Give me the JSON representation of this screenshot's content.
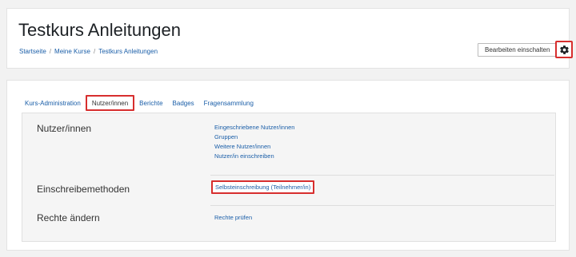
{
  "header": {
    "title": "Testkurs Anleitungen",
    "breadcrumb": [
      "Startseite",
      "Meine Kurse",
      "Testkurs Anleitungen"
    ],
    "breadcrumb_sep": "/",
    "edit_button": "Bearbeiten einschalten",
    "gear_icon": "gear-icon"
  },
  "tabs": [
    {
      "label": "Kurs-Administration"
    },
    {
      "label": "Nutzer/innen",
      "active": true
    },
    {
      "label": "Berichte"
    },
    {
      "label": "Badges"
    },
    {
      "label": "Fragensammlung"
    }
  ],
  "sections": [
    {
      "title": "Nutzer/innen",
      "links": [
        "Eingeschriebene Nutzer/innen",
        "Gruppen",
        "Weitere Nutzer/innen",
        "Nutzer/in einschreiben"
      ]
    },
    {
      "title": "Einschreibemethoden",
      "links": [
        "Selbsteinschreibung (Teilnehmer/in)"
      ]
    },
    {
      "title": "Rechte ändern",
      "links": [
        "Rechte prüfen"
      ]
    }
  ],
  "colors": {
    "link": "#1a5ea8",
    "highlight": "#d72e2e"
  }
}
